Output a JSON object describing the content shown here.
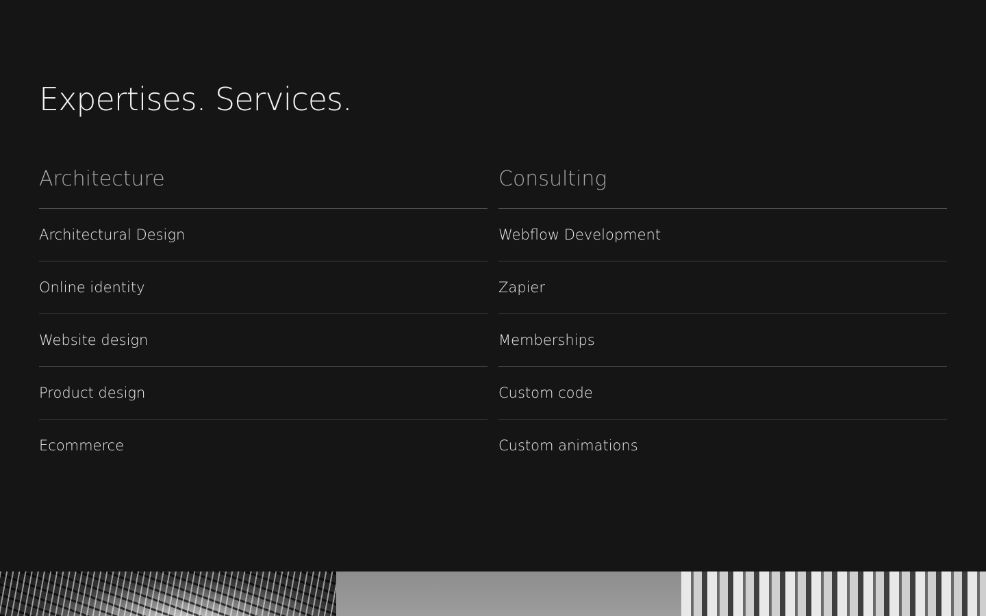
{
  "section": {
    "heading": "Expertises. Services."
  },
  "columns": [
    {
      "title": "Architecture",
      "items": [
        "Architectural Design",
        "Online identity",
        "Website design",
        "Product design",
        "Ecommerce"
      ]
    },
    {
      "title": "Consulting",
      "items": [
        "Webflow Development",
        "Zapier",
        "Memberships",
        "Custom code",
        "Custom animations"
      ]
    }
  ],
  "colors": {
    "background": "#151515",
    "heading": "#f5f5f5",
    "column_title": "#a8a8a8",
    "item_text": "#ececec",
    "divider": "#3e3e3e"
  }
}
